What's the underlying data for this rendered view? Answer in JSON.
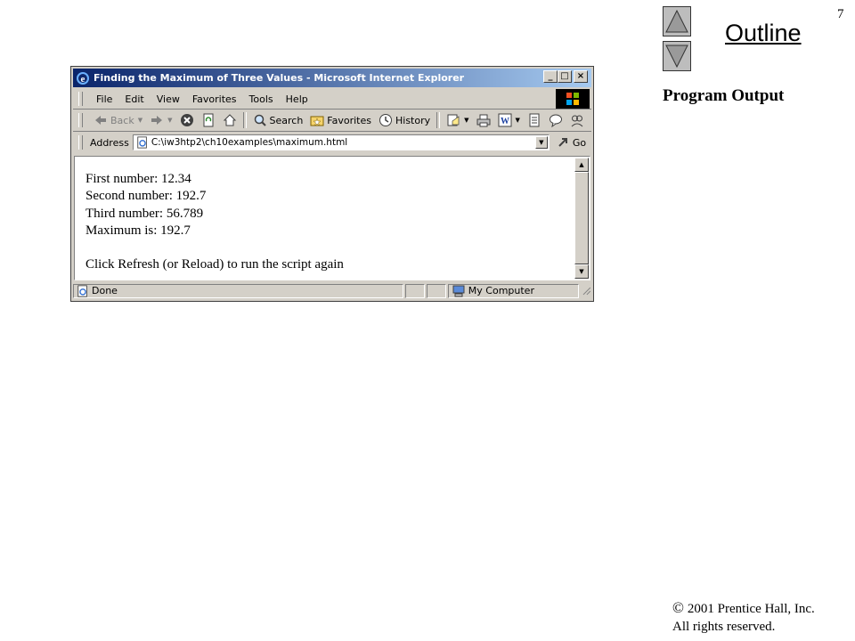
{
  "slide": {
    "page_number": "7",
    "outline_label": "Outline",
    "section_title": "Program Output",
    "copyright_symbol": "©",
    "copyright_line1": "2001 Prentice Hall, Inc.",
    "copyright_line2": "All rights reserved."
  },
  "browser": {
    "title": "Finding the Maximum of Three Values - Microsoft Internet Explorer",
    "window_buttons": {
      "minimize": "_",
      "maximize": "□",
      "close": "×"
    },
    "menu": [
      "File",
      "Edit",
      "View",
      "Favorites",
      "Tools",
      "Help"
    ],
    "toolbar": {
      "back": "Back",
      "search": "Search",
      "favorites": "Favorites",
      "history": "History"
    },
    "address_label": "Address",
    "address_value": "C:\\iw3htp2\\ch10examples\\maximum.html",
    "go_label": "Go",
    "content_lines": [
      "First number: 12.34",
      "Second number: 192.7",
      "Third number: 56.789",
      "Maximum is: 192.7"
    ],
    "content_footer": "Click Refresh (or Reload) to run the script again",
    "status_text": "Done",
    "zone_text": "My Computer"
  },
  "colors": {
    "title_gradient_start": "#0a246a",
    "title_gradient_end": "#a6caf0",
    "chrome": "#d4d0c8"
  }
}
